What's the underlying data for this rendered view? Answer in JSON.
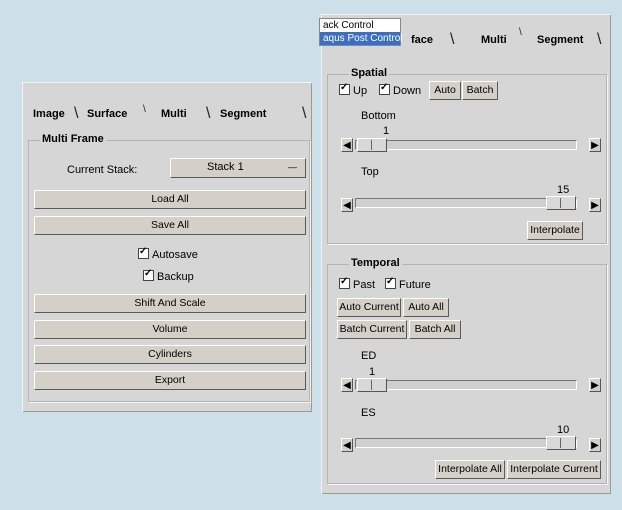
{
  "left_panel": {
    "tabs": [
      "Image",
      "Surface",
      "Multi",
      "Segment"
    ],
    "group_title": "Multi Frame",
    "current_stack_label": "Current Stack:",
    "current_stack_value": "Stack 1",
    "buttons": {
      "load_all": "Load All",
      "save_all": "Save All",
      "shift_and_scale": "Shift And Scale",
      "volume": "Volume",
      "cylinders": "Cylinders",
      "export": "Export"
    },
    "checkboxes": {
      "autosave": "Autosave",
      "backup": "Backup"
    }
  },
  "right_panel": {
    "tabs": [
      "face",
      "Multi",
      "Segment"
    ],
    "menu": [
      "ack Control",
      "aqus Post Control"
    ],
    "spatial": {
      "title": "Spatial",
      "up": "Up",
      "down": "Down",
      "auto": "Auto",
      "batch": "Batch",
      "bottom_label": "Bottom",
      "bottom_value": "1",
      "top_label": "Top",
      "top_value": "15",
      "interpolate": "Interpolate"
    },
    "temporal": {
      "title": "Temporal",
      "past": "Past",
      "future": "Future",
      "auto_current": "Auto Current",
      "auto_all": "Auto All",
      "batch_current": "Batch Current",
      "batch_all": "Batch All",
      "ed_label": "ED",
      "ed_value": "1",
      "es_label": "ES",
      "es_value": "10",
      "interpolate_all": "Interpolate All",
      "interpolate_current": "Interpolate Current"
    }
  },
  "icons": {
    "left_arrow": "◀",
    "right_arrow": "▶",
    "dropdown": "—"
  }
}
